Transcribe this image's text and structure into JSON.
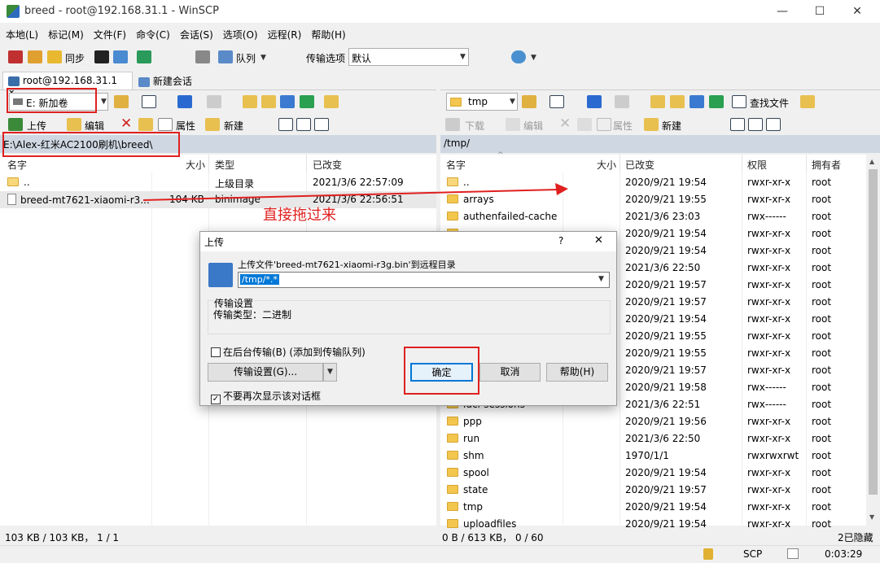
{
  "window": {
    "title": "breed - root@192.168.31.1 - WinSCP",
    "min": "—",
    "max": "☐",
    "close": "✕"
  },
  "menu": [
    "本地(L)",
    "标记(M)",
    "文件(F)",
    "命令(C)",
    "会话(S)",
    "选项(O)",
    "远程(R)",
    "帮助(H)"
  ],
  "toolbar": {
    "sync": "同步",
    "queue": "队列",
    "transfer_opts_label": "传输选项",
    "transfer_opts_value": "默认"
  },
  "tabs": {
    "session": "root@192.168.31.1",
    "session_close": "✕",
    "new_session": "新建会话"
  },
  "left": {
    "drive": "E: 新加卷",
    "upload": "上传",
    "edit": "编辑",
    "props": "属性",
    "new": "新建",
    "path": "E:\\Alex-红米AC2100刷机\\breed\\",
    "cols": {
      "name": "名字",
      "size": "大小",
      "type": "类型",
      "changed": "已改变"
    },
    "rows": [
      {
        "name": "..",
        "size": "",
        "type": "上级目录",
        "changed": "2021/3/6  22:57:09"
      },
      {
        "name": "breed-mt7621-xiaomi-r3...",
        "size": "104 KB",
        "type": "binimage",
        "changed": "2021/3/6  22:56:51"
      }
    ],
    "status": "103 KB / 103 KB， 1 / 1"
  },
  "right": {
    "dir": "tmp",
    "find": "查找文件",
    "download": "下载",
    "edit": "编辑",
    "props": "属性",
    "new": "新建",
    "path": "/tmp/",
    "cols": {
      "name": "名字",
      "size": "大小",
      "changed": "已改变",
      "rights": "权限",
      "owner": "拥有者"
    },
    "rows": [
      {
        "name": "..",
        "changed": "2020/9/21 19:54",
        "rights": "rwxr-xr-x",
        "owner": "root"
      },
      {
        "name": "arrays",
        "changed": "2020/9/21 19:55",
        "rights": "rwxr-xr-x",
        "owner": "root"
      },
      {
        "name": "authenfailed-cache",
        "changed": "2021/3/6 23:03",
        "rights": "rwx------",
        "owner": "root"
      },
      {
        "name": "",
        "changed": "2020/9/21 19:54",
        "rights": "rwxr-xr-x",
        "owner": "root"
      },
      {
        "name": "",
        "changed": "2020/9/21 19:54",
        "rights": "rwxr-xr-x",
        "owner": "root"
      },
      {
        "name": "",
        "changed": "2021/3/6 22:50",
        "rights": "rwxr-xr-x",
        "owner": "root"
      },
      {
        "name": "",
        "changed": "2020/9/21 19:57",
        "rights": "rwxr-xr-x",
        "owner": "root"
      },
      {
        "name": "",
        "changed": "2020/9/21 19:57",
        "rights": "rwxr-xr-x",
        "owner": "root"
      },
      {
        "name": "",
        "changed": "2020/9/21 19:54",
        "rights": "rwxr-xr-x",
        "owner": "root"
      },
      {
        "name": "",
        "changed": "2020/9/21 19:55",
        "rights": "rwxr-xr-x",
        "owner": "root"
      },
      {
        "name": "",
        "changed": "2020/9/21 19:55",
        "rights": "rwxr-xr-x",
        "owner": "root"
      },
      {
        "name": "",
        "changed": "2020/9/21 19:57",
        "rights": "rwxr-xr-x",
        "owner": "root"
      },
      {
        "name": "",
        "changed": "2020/9/21 19:58",
        "rights": "rwx------",
        "owner": "root"
      },
      {
        "name": "luci-sessions",
        "changed": "2021/3/6 22:51",
        "rights": "rwx------",
        "owner": "root"
      },
      {
        "name": "ppp",
        "changed": "2020/9/21 19:56",
        "rights": "rwxr-xr-x",
        "owner": "root"
      },
      {
        "name": "run",
        "changed": "2021/3/6 22:50",
        "rights": "rwxr-xr-x",
        "owner": "root"
      },
      {
        "name": "shm",
        "changed": "1970/1/1",
        "rights": "rwxrwxrwt",
        "owner": "root"
      },
      {
        "name": "spool",
        "changed": "2020/9/21 19:54",
        "rights": "rwxr-xr-x",
        "owner": "root"
      },
      {
        "name": "state",
        "changed": "2020/9/21 19:57",
        "rights": "rwxr-xr-x",
        "owner": "root"
      },
      {
        "name": "tmp",
        "changed": "2020/9/21 19:54",
        "rights": "rwxr-xr-x",
        "owner": "root"
      },
      {
        "name": "uploadfiles",
        "changed": "2020/9/21 19:54",
        "rights": "rwxr-xr-x",
        "owner": "root"
      }
    ],
    "status": "0 B / 613 KB， 0 / 60"
  },
  "annotation": "直接拖过来",
  "dialog": {
    "title": "上传",
    "help_q": "?",
    "close": "✕",
    "message": "上传文件'breed-mt7621-xiaomi-r3g.bin'到远程目录",
    "target": "/tmp/*.*",
    "settings_title": "传输设置",
    "settings_type": "传输类型：二进制",
    "background": "在后台传输(B) (添加到传输队列)",
    "settings_btn": "传输设置(G)...",
    "ok": "确定",
    "cancel": "取消",
    "help": "帮助(H)",
    "dont_show": "不要再次显示该对话框"
  },
  "bottom": {
    "protocol": "SCP",
    "time": "0:03:29",
    "hidden": "2已隐藏"
  }
}
